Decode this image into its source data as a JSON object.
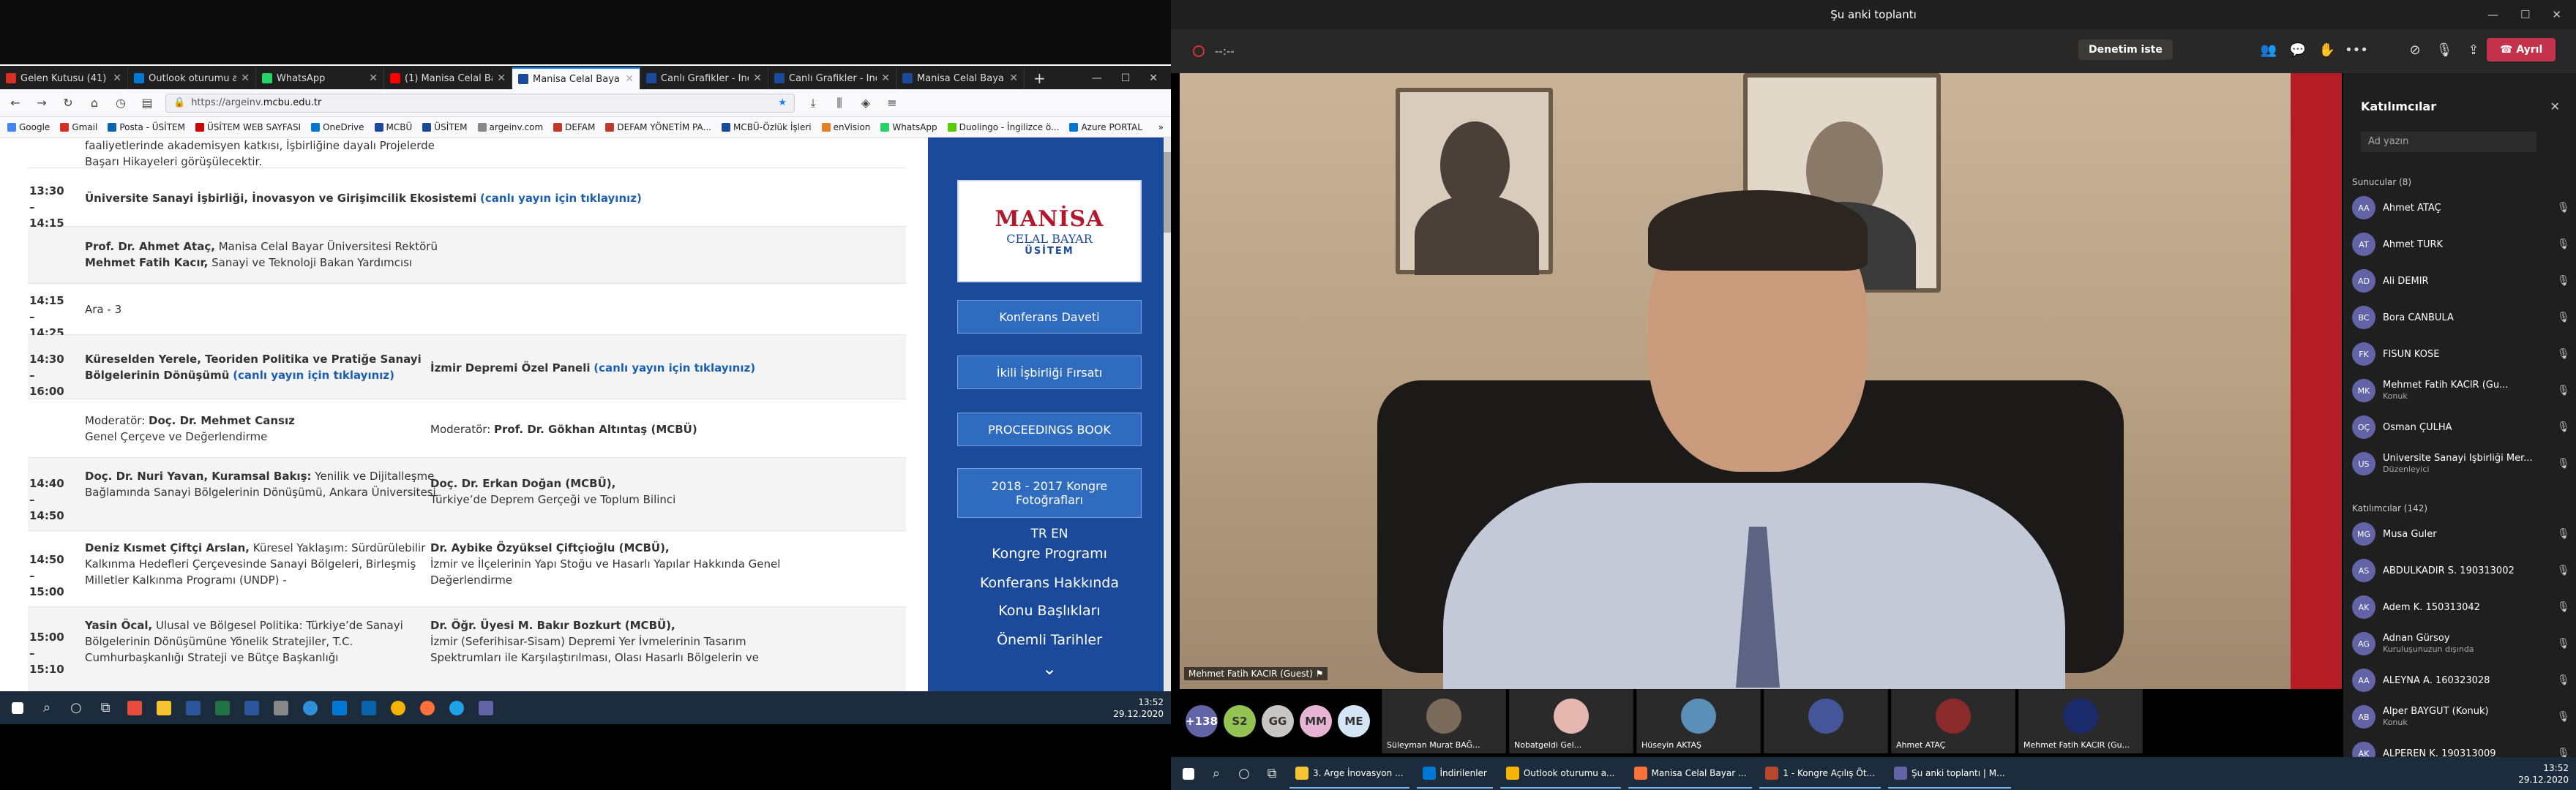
{
  "browser": {
    "tabs": [
      {
        "label": "Gelen Kutusu (41)",
        "color": "#d93025"
      },
      {
        "label": "Outlook oturumu a...",
        "color": "#0078d4"
      },
      {
        "label": "WhatsApp",
        "color": "#25d366"
      },
      {
        "label": "(1) Manisa Celal Ba...",
        "color": "#ff0000"
      },
      {
        "label": "Manisa Celal Bayar Ü...",
        "color": "#1a4a99",
        "active": true
      },
      {
        "label": "Canlı Grafikler - İnov...",
        "color": "#1a4a99"
      },
      {
        "label": "Canlı Grafikler - İnov...",
        "color": "#1a4a99"
      },
      {
        "label": "Manisa Celal Bayar Ü...",
        "color": "#1a4a99"
      }
    ],
    "url_prefix": "https://argeinv.",
    "url_host": "mcbu.edu.tr",
    "bookmarks": [
      "Google",
      "Gmail",
      "Posta - ÜSİTEM",
      "ÜSİTEM WEB SAYFASI",
      "OneDrive",
      "MCBÜ",
      "ÜSİTEM",
      "argeinv.com",
      "DEFAM",
      "DEFAM YÖNETİM PA...",
      "MCBÜ-Özlük İşleri",
      "enVision",
      "WhatsApp",
      "Duolingo - İngilizce ö...",
      "Azure PORTAL"
    ]
  },
  "schedule": {
    "top_text": "faaliyetlerinde akademisyen katkısı, İşbirliğine dayalı Projelerde Başarı Hikayeleri görüşülecektir.",
    "r1_time": "13:30 – 14:15",
    "r1_title": "Üniversite Sanayi İşbirliği, İnovasyon ve Girişimcilik Ekosistemi",
    "live": "(canlı yayın için tıklayınız)",
    "r2_name1": "Prof. Dr. Ahmet Ataç,",
    "r2_role1": "Manisa Celal Bayar Üniversitesi Rektörü",
    "r2_name2": "Mehmet Fatih Kacır,",
    "r2_role2": "Sanayi ve Teknoloji Bakan Yardımcısı",
    "r3_time": "14:15 – 14:25",
    "r3_title": "Ara - 3",
    "r4_time": "14:30 – 16:00",
    "r4_title": "Küreselden Yerele, Teoriden Politika ve Pratiğe Sanayi Bölgelerinin Dönüşümü",
    "r4_right": "İzmir Depremi Özel Paneli",
    "r5_mod_l": "Moderatör:",
    "r5_mod_name": "Doç. Dr. Mehmet Cansız",
    "r5_mod_sub": "Genel Çerçeve ve Değerlendirme",
    "r5_mod_r": "Moderatör:",
    "r5_mod_rname": "Prof. Dr. Gökhan Altıntaş (MCBÜ)",
    "r6_time": "14:40 – 14:50",
    "r6_l_b": "Doç. Dr. Nuri Yavan, Kuramsal Bakış:",
    "r6_l": "Yenilik ve Dijitalleşme Bağlamında Sanayi Bölgelerinin Dönüşümü, Ankara Üniversitesi",
    "r6_r_b": "Doç. Dr. Erkan Doğan (MCBÜ),",
    "r6_r": "Türkiye’de Deprem Gerçeği ve Toplum Bilinci",
    "r7_time": "14:50 – 15:00",
    "r7_l_b": "Deniz Kısmet Çiftçi Arslan,",
    "r7_l": "Küresel Yaklaşım: Sürdürülebilir Kalkınma Hedefleri Çerçevesinde Sanayi Bölgeleri, Birleşmiş Milletler Kalkınma Programı (UNDP) -",
    "r7_r_b": "Dr. Aybike Özyüksel Çiftçioğlu (MCBÜ),",
    "r7_r": "İzmir ve İlçelerinin Yapı Stoğu ve Hasarlı Yapılar Hakkında Genel Değerlendirme",
    "r8_time": "15:00 – 15:10",
    "r8_l_b": "Yasin Öcal,",
    "r8_l": "Ulusal ve Bölgesel Politika: Türkiye’de Sanayi Bölgelerinin Dönüşümüne Yönelik Stratejiler, T.C. Cumhurbaşkanlığı Strateji ve Bütçe Başkanlığı",
    "r8_r_b": "Dr. Öğr. Üyesi M. Bakır Bozkurt (MCBÜ),",
    "r8_r": "İzmir (Seferihisar-Sisam) Depremi Yer İvmelerinin Tasarım Spektrumları ile Karşılaştırılması, Olası Hasarlı Bölgelerin ve"
  },
  "sidebar": {
    "logo1": "MANİSA",
    "logo2": "CELAL BAYAR",
    "logo3": "ÜSİTEM",
    "btn1": "Konferans Daveti",
    "btn2": "İkili İşbirliği Fırsatı",
    "btn3": "PROCEEDINGS BOOK",
    "btn4": "2018 - 2017 Kongre Fotoğrafları",
    "lang": "TR EN",
    "l1": "Kongre Programı",
    "l2": "Konferans Hakkında",
    "l3": "Konu Başlıkları",
    "l4": "Önemli Tarihler"
  },
  "taskbar_left": {
    "time": "13:52",
    "date": "29.12.2020"
  },
  "teams": {
    "title": "Şu anki toplantı",
    "timer": "--:--",
    "control_btn": "Denetim iste",
    "leave": "Ayrıl",
    "video_label": "Mehmet Fatih KACIR (Guest)",
    "overflow": "+138",
    "avatars": [
      {
        "t": "S2",
        "c": "#92c353"
      },
      {
        "t": "GG",
        "c": "#c8c6c4"
      },
      {
        "t": "MM",
        "c": "#e8b4d4"
      },
      {
        "t": "ME",
        "c": "#d4e6f5"
      }
    ],
    "tiles": [
      "Süleyman Murat BAĞ...",
      "Nobatgeldi Gel...",
      "Hüseyin AKTAŞ",
      "",
      "Ahmet ATAÇ",
      "Mehmet Fatih KACIR (Gu..."
    ],
    "panel_title": "Katılımcılar",
    "search_ph": "Ad yazın",
    "presenters_label": "Sunucular (8)",
    "presenters": [
      {
        "n": "Ahmet ATAÇ",
        "s": "",
        "i": "AA"
      },
      {
        "n": "Ahmet TÜRK",
        "s": "",
        "i": "AT"
      },
      {
        "n": "Ali DEMİR",
        "s": "",
        "i": "AD"
      },
      {
        "n": "Bora CANBULA",
        "s": "",
        "i": "BC"
      },
      {
        "n": "FİSUN KÖSE",
        "s": "",
        "i": "FK"
      },
      {
        "n": "Mehmet Fatih KACIR (Gu...",
        "s": "Konuk",
        "i": "MK"
      },
      {
        "n": "Osman ÇULHA",
        "s": "",
        "i": "OÇ"
      },
      {
        "n": "Universite Sanayi İşbirliği Mer...",
        "s": "Düzenleyici",
        "i": "US"
      }
    ],
    "attendees_label": "Katılımcılar (142)",
    "attendees": [
      {
        "n": "Musa Guler",
        "s": "",
        "i": "MG"
      },
      {
        "n": "ABDÜLKADİR S. 190313002",
        "s": "",
        "i": "AS"
      },
      {
        "n": "Adem K. 150313042",
        "s": "",
        "i": "AK"
      },
      {
        "n": "Adnan Gürsoy",
        "s": "Kuruluşunuzun dışında",
        "i": "AG"
      },
      {
        "n": "ALEYNA A. 160323028",
        "s": "",
        "i": "AA"
      },
      {
        "n": "Alper BAYGUT (Konuk)",
        "s": "Konuk",
        "i": "AB"
      },
      {
        "n": "ALPEREN K. 190313009",
        "s": "",
        "i": "AK"
      }
    ]
  },
  "taskbar_right": {
    "apps": [
      "3. Arge İnovasyon ...",
      "İndirilenler",
      "Outlook oturumu a...",
      "Manisa Celal Bayar ...",
      "1 - Kongre Açılış Öt...",
      "Şu anki toplantı | M..."
    ],
    "time": "13:52",
    "date": "29.12.2020"
  }
}
